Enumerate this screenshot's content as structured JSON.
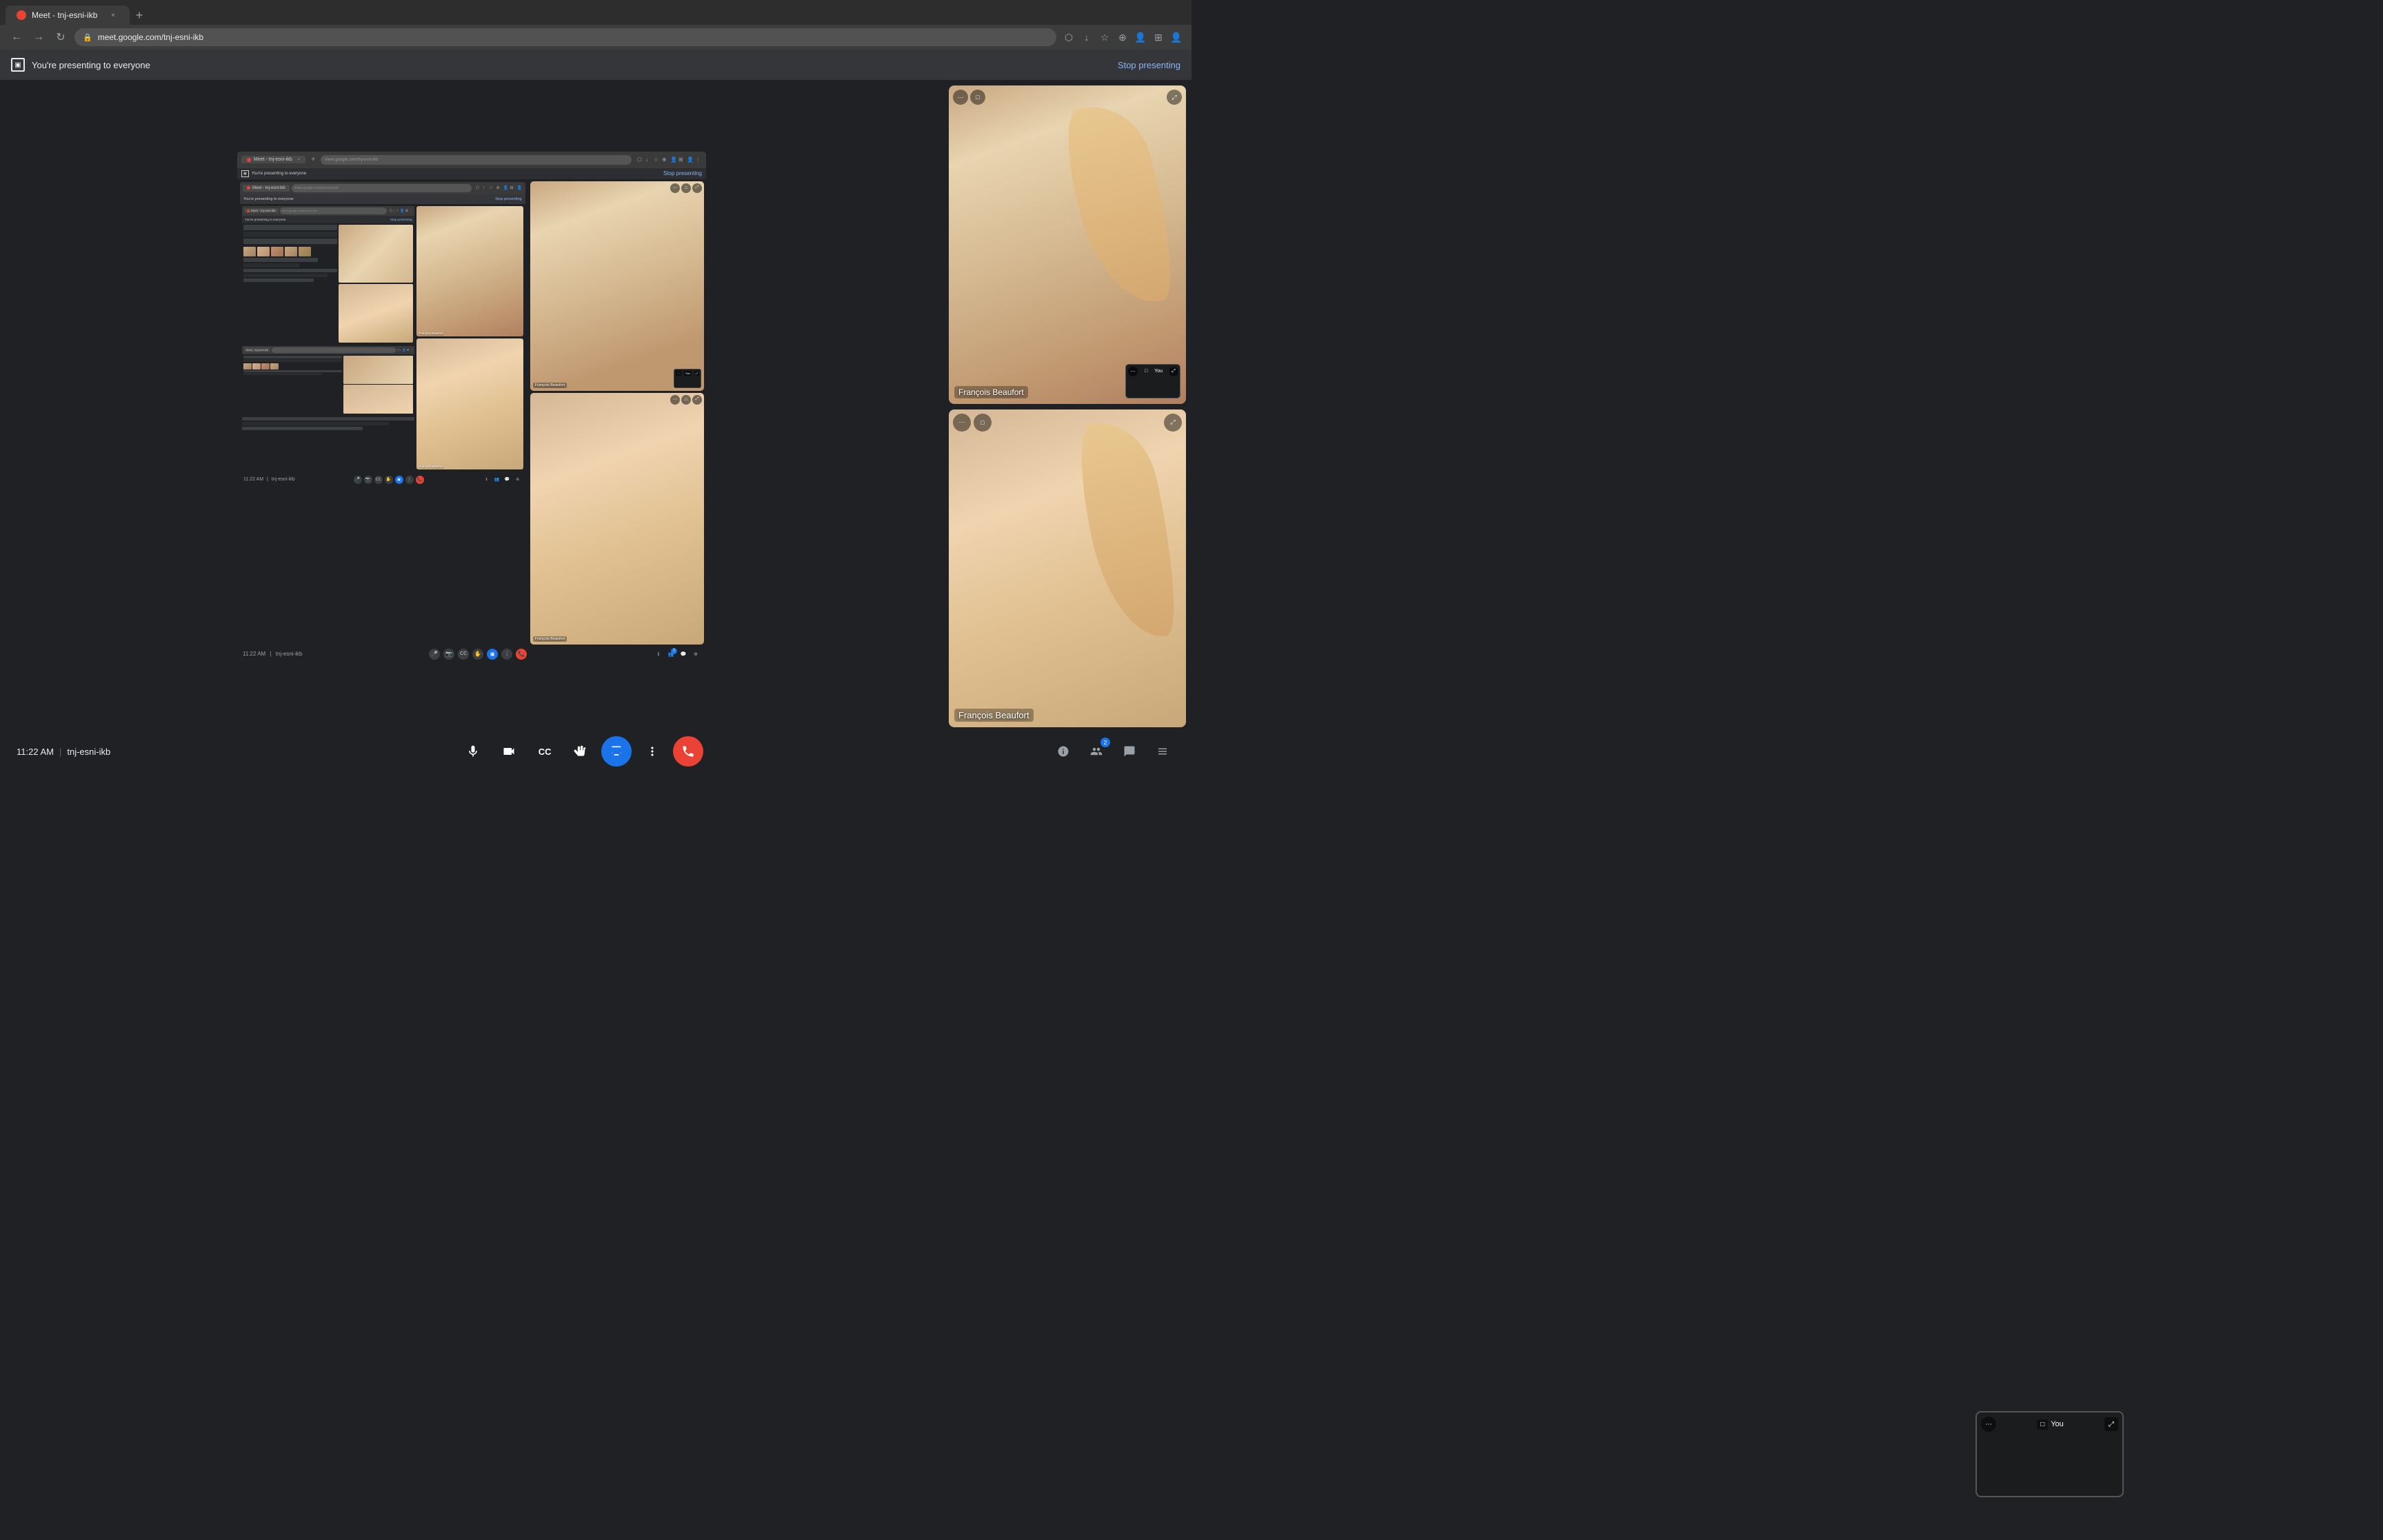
{
  "browser": {
    "tab_title": "Meet - tnj-esni-ikb",
    "tab_favicon": "red-circle",
    "url": "meet.google.com/tnj-esni-ikb",
    "new_tab_label": "+",
    "close_label": "×"
  },
  "presenting_banner": {
    "icon": "⬡",
    "message": "You're presenting to everyone",
    "stop_label": "Stop presenting"
  },
  "nested": {
    "tab_title": "Meet - tnj-esni-ikb",
    "url": "meet.google.com/tnj-esni-ikb",
    "banner_message": "You're presenting to everyone",
    "stop_label": "Stop presenting",
    "deep_banner_message": "You're presenting to everyone",
    "deep_stop_label": "Stop presenting"
  },
  "participants": {
    "francois": {
      "name": "François Beaufort"
    },
    "you": {
      "name": "You"
    }
  },
  "toolbar": {
    "time": "11:22 AM",
    "meeting_id": "tnj-esni-ikb",
    "separator": "|",
    "mic_label": "mic",
    "camera_label": "camera",
    "captions_label": "captions",
    "raise_hand_label": "raise hand",
    "present_label": "present",
    "more_label": "more",
    "end_call_label": "end call"
  },
  "right_toolbar": {
    "info_label": "info",
    "people_label": "people",
    "chat_label": "chat",
    "activities_label": "activities",
    "people_badge": "2"
  },
  "you_tile": {
    "dots_label": "⋯",
    "screen_label": "□",
    "you_label": "You",
    "expand_label": "⤢"
  },
  "icons": {
    "mic": "🎤",
    "camera": "📷",
    "captions": "CC",
    "raise_hand": "✋",
    "present": "⬡",
    "more": "⋮",
    "end_call": "📞",
    "info": "ℹ",
    "people": "👥",
    "chat": "💬",
    "activities": "⋯"
  }
}
